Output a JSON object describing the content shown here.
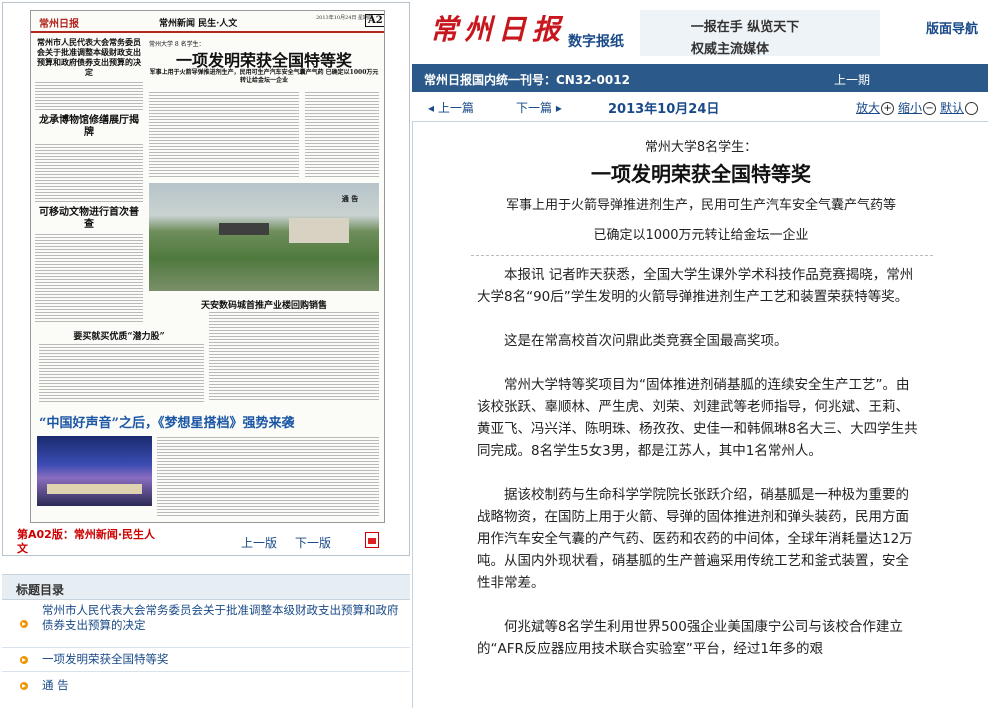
{
  "paper": {
    "logo": "常州日报",
    "section": "常州新闻  民生·人文",
    "date_line": "2013年10月24日 星期四",
    "page_no": "A2",
    "kicker": "常州大学 8 名学生：",
    "headline": "一项发明荣获全国特等奖",
    "subhead": "军事上用于火箭导弹推进剂生产，民用可生产汽车安全气囊产气药 已确定以1000万元转让给金坛一企业",
    "left_head1": "常州市人民代表大会常务委员会关于批准调整本级财政支出预算和政府债券支出预算的决定",
    "left_head2": "龙承博物馆修缮展厅揭牌",
    "left_head3": "可移动文物进行首次普查",
    "notice": "通  告",
    "story2": "天安数码城首推产业楼回购销售",
    "story3": "要买就买优质“潜力股”",
    "big_head": "“中国好声音”之后，《梦想星搭档》强势来袭",
    "footer_label": "第A02版：常州新闻·民生人文",
    "prev_label": "上一版",
    "next_label": "下一版",
    "pdf_icon": "pdf-icon"
  },
  "title_list": {
    "heading": "标题目录",
    "items": [
      "常州市人民代表大会常务委员会关于批准调整本级财政支出预算和政府债券支出预算的决定",
      "一项发明荣获全国特等奖",
      "通  告"
    ]
  },
  "header": {
    "logo_text": "常州日报",
    "sub_brand": "数字报纸",
    "slogan_1": "一报在手  纵览天下",
    "slogan_2": "权威主流媒体",
    "nav_label": "版面导航"
  },
  "bar": {
    "issn": "常州日报国内统一刊号：CN32-0012",
    "prev_issue": "上一期"
  },
  "toolbar": {
    "prev_article": "上一篇",
    "next_article": "下一篇",
    "date": "2013年10月24日",
    "zoom_in": "放大",
    "zoom_out": "缩小",
    "default": "默认"
  },
  "article": {
    "kicker": "常州大学8名学生：",
    "title": "一项发明荣获全国特等奖",
    "subtitle_1": "军事上用于火箭导弹推进剂生产，民用可生产汽车安全气囊产气药等",
    "subtitle_2": "已确定以1000万元转让给金坛一企业",
    "paragraphs": [
      "本报讯 记者昨天获悉，全国大学生课外学术科技作品竞赛揭晓，常州大学8名“90后”学生发明的火箭导弹推进剂生产工艺和装置荣获特等奖。",
      "这是在常高校首次问鼎此类竞赛全国最高奖项。",
      "常州大学特等奖项目为“固体推进剂硝基胍的连续安全生产工艺”。由该校张跃、辜顺林、严生虎、刘荣、刘建武等老师指导，何兆斌、王莉、黄亚飞、冯兴洋、陈明珠、杨孜孜、史佳一和韩佩琳8名大三、大四学生共同完成。8名学生5女3男，都是江苏人，其中1名常州人。",
      "据该校制药与生命科学学院院长张跃介绍，硝基胍是一种极为重要的战略物资，在国防上用于火箭、导弹的固体推进剂和弹头装药，民用方面用作汽车安全气囊的产气药、医药和农药的中间体，全球年消耗量达12万吨。从国内外现状看，硝基胍的生产普遍采用传统工艺和釜式装置，安全性非常差。",
      "何兆斌等8名学生利用世界500强企业美国康宁公司与该校合作建立的“AFR反应器应用技术联合实验室”平台，经过1年多的艰"
    ]
  }
}
